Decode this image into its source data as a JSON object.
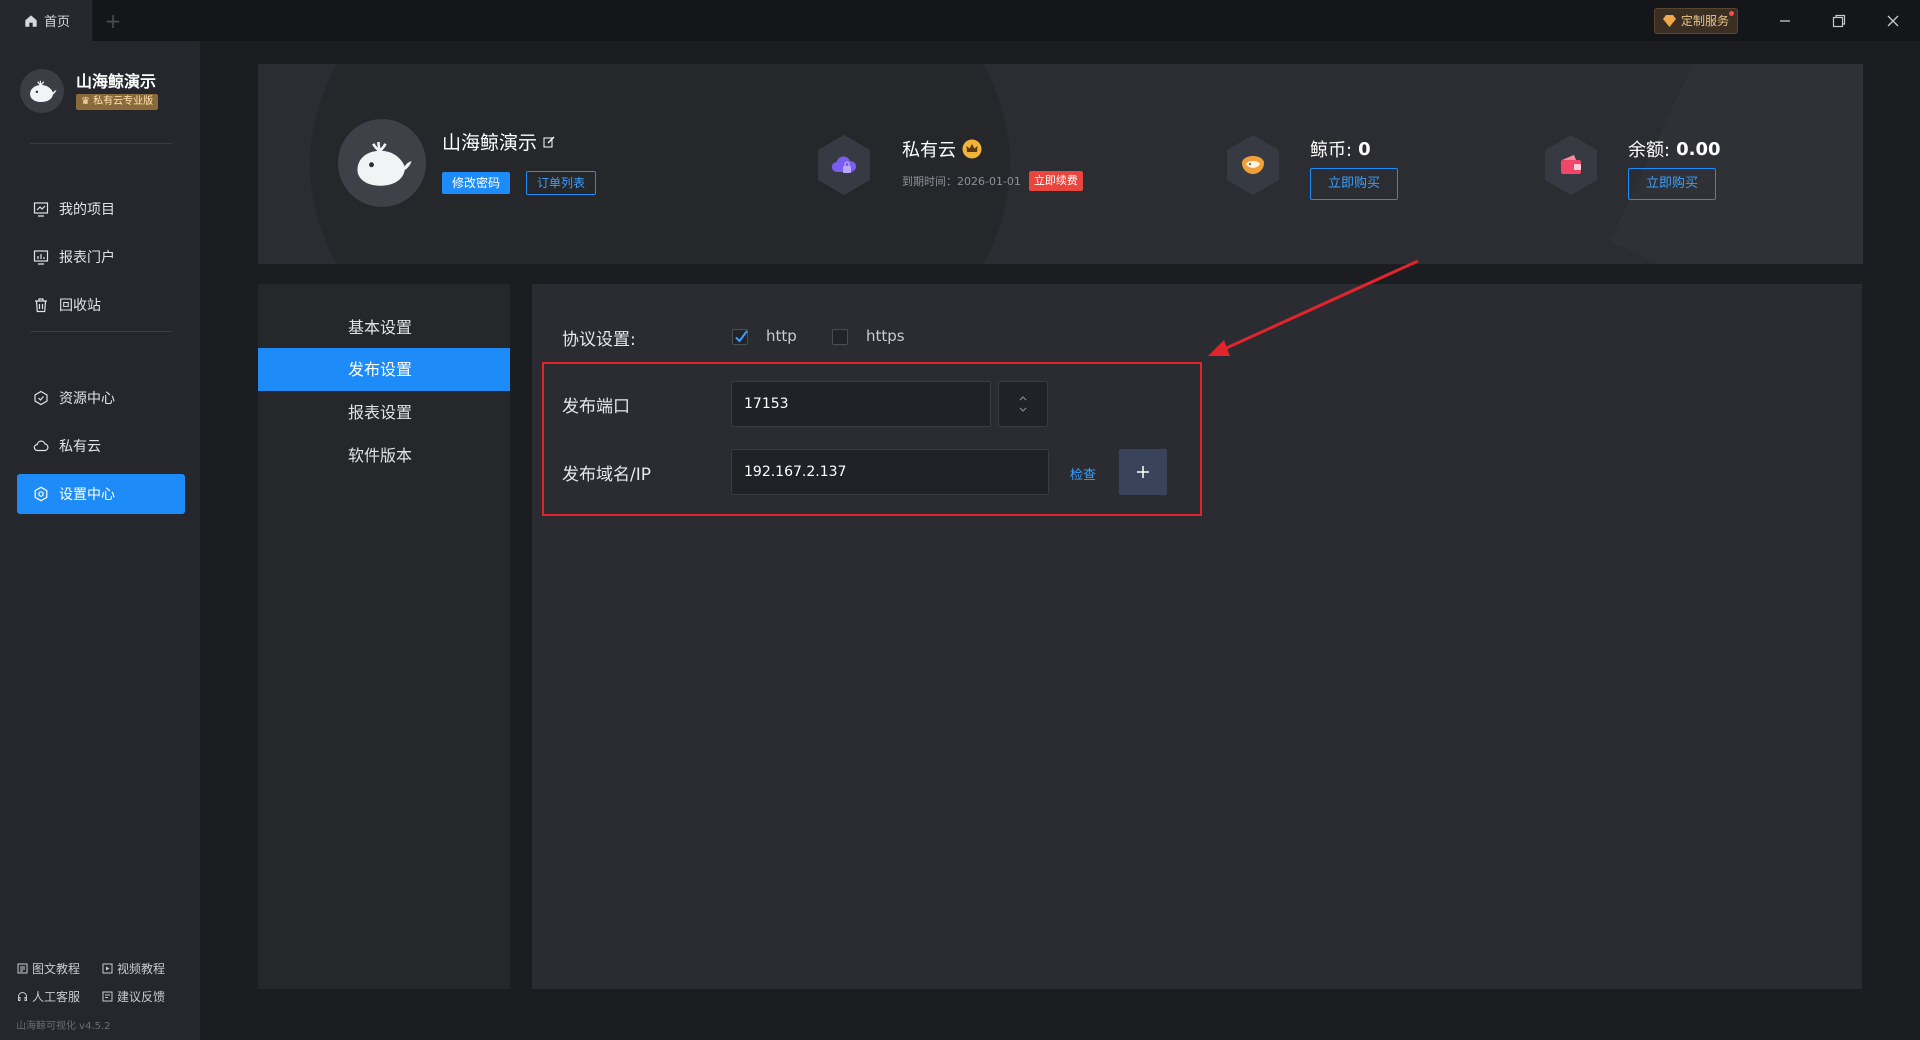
{
  "titlebar": {
    "home_tab": "首页",
    "custom_service": "定制服务"
  },
  "sidebar": {
    "brand_name": "山海鲸演示",
    "brand_badge": "♛ 私有云专业版",
    "items": [
      {
        "label": "我的项目",
        "icon": "project-icon"
      },
      {
        "label": "报表门户",
        "icon": "report-portal-icon"
      },
      {
        "label": "回收站",
        "icon": "trash-icon"
      },
      {
        "label": "资源中心",
        "icon": "resource-icon"
      },
      {
        "label": "私有云",
        "icon": "cloud-icon"
      },
      {
        "label": "设置中心",
        "icon": "settings-icon",
        "active": true
      }
    ],
    "footer": {
      "tutorial_text": "图文教程",
      "tutorial_video": "视频教程",
      "support": "人工客服",
      "feedback": "建议反馈",
      "version": "山海鲸可视化 v4.5.2"
    }
  },
  "header": {
    "user_name": "山海鲸演示",
    "change_password": "修改密码",
    "order_list": "订单列表",
    "private_cloud": {
      "title": "私有云",
      "expire_text": "到期时间：2026-01-01",
      "renew": "立即续费"
    },
    "whale_coin": {
      "label": "鲸币:",
      "value": "0",
      "buy": "立即购买"
    },
    "balance": {
      "label": "余额:",
      "value": "0.00",
      "buy": "立即购买"
    }
  },
  "settings_menu": {
    "items": [
      "基本设置",
      "发布设置",
      "报表设置",
      "软件版本"
    ],
    "active_index": 1
  },
  "publish": {
    "protocol_label": "协议设置:",
    "protocol_http": "http",
    "protocol_https": "https",
    "http_checked": true,
    "https_checked": false,
    "port_label": "发布端口",
    "port_value": "17153",
    "domain_label": "发布域名/IP",
    "domain_value": "192.167.2.137",
    "check_link": "检查"
  },
  "colors": {
    "accent": "#1d8cf8",
    "highlight_box": "#e0252c",
    "renew": "#e8453c"
  }
}
